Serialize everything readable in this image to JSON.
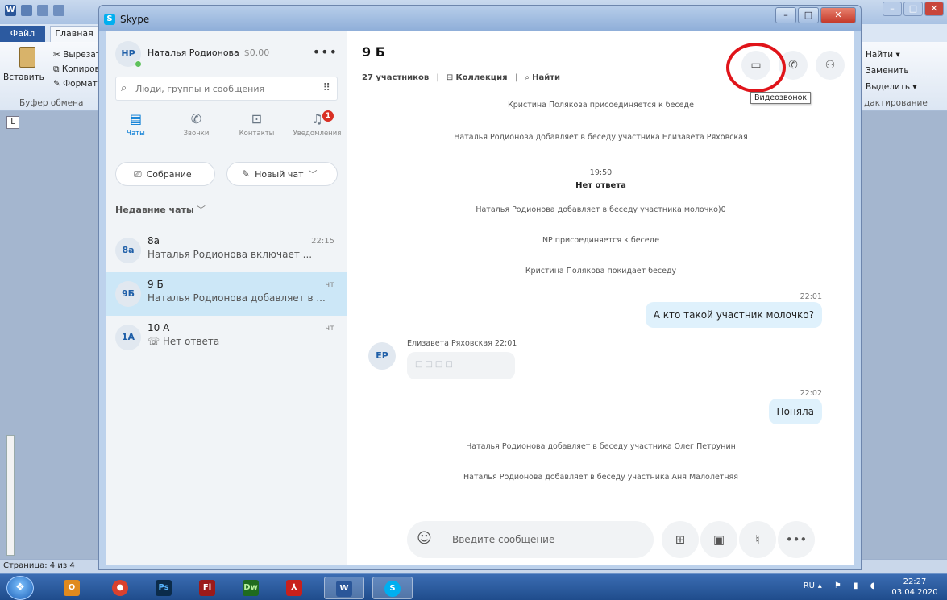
{
  "word": {
    "file_tab": "Файл",
    "home_tab": "Главная",
    "clipboard": {
      "paste": "Вставить",
      "cut": "Вырезать",
      "copy": "Копиров",
      "format_painter": "Формат п",
      "group": "Буфер обмена"
    },
    "editing": {
      "find": "Найти",
      "replace": "Заменить",
      "select": "Выделить",
      "group": "дактирование"
    },
    "status": "Страница: 4 из 4"
  },
  "skype": {
    "window_title": "Skype",
    "profile": {
      "initials": "НР",
      "name": "Наталья Родионова",
      "credit": "$0.00"
    },
    "search_placeholder": "Люди, группы и сообщения",
    "nav": {
      "chats": "Чаты",
      "calls": "Звонки",
      "contacts": "Контакты",
      "notifications": "Уведомления",
      "notifications_count": "1"
    },
    "meet_now": "Собрание",
    "new_chat": "Новый чат",
    "recent_header": "Недавние чаты",
    "chats": [
      {
        "initials": "8a",
        "name": "8a",
        "time": "22:15",
        "last": "Наталья Родионова включает ...",
        "active": false
      },
      {
        "initials": "9Б",
        "name": "9 Б",
        "time": "чт",
        "last": "Наталья Родионова добавляет в ...",
        "active": true
      },
      {
        "initials": "1A",
        "name": "10 A",
        "time": "чт",
        "last": "Нет ответа",
        "active": false
      }
    ],
    "conversation": {
      "title": "9 Б",
      "participants": "27 участников",
      "collection": "Коллекция",
      "find": "Найти",
      "tooltip": "Видеозвонок",
      "messages": {
        "sys1": "Кристина Полякова присоединяется к беседе",
        "sys2": "Наталья Родионова добавляет в беседу участника Елизавета Ряховская",
        "time1": "19:50",
        "no_answer": "Нет ответа",
        "sys3": "Наталья Родионова добавляет в беседу участника молочко)0",
        "sys4": "NP присоединяется к беседе",
        "sys5": "Кристина Полякова покидает беседу",
        "out_time1": "22:01",
        "out_text1": "А кто такой участник молочко?",
        "in_sender": "Елизавета Ряховская 22:01",
        "in_initials": "ЕР",
        "in_text": "□□□□",
        "out_time2": "22:02",
        "out_text2": "Поняла",
        "sys6": "Наталья Родионова добавляет в беседу участника Олег Петрунин",
        "sys7": "Наталья Родионова добавляет в беседу участника Аня Малолетняя"
      },
      "composer_placeholder": "Введите сообщение"
    }
  },
  "taskbar": {
    "lang": "RU",
    "time": "22:27",
    "date": "03.04.2020"
  }
}
